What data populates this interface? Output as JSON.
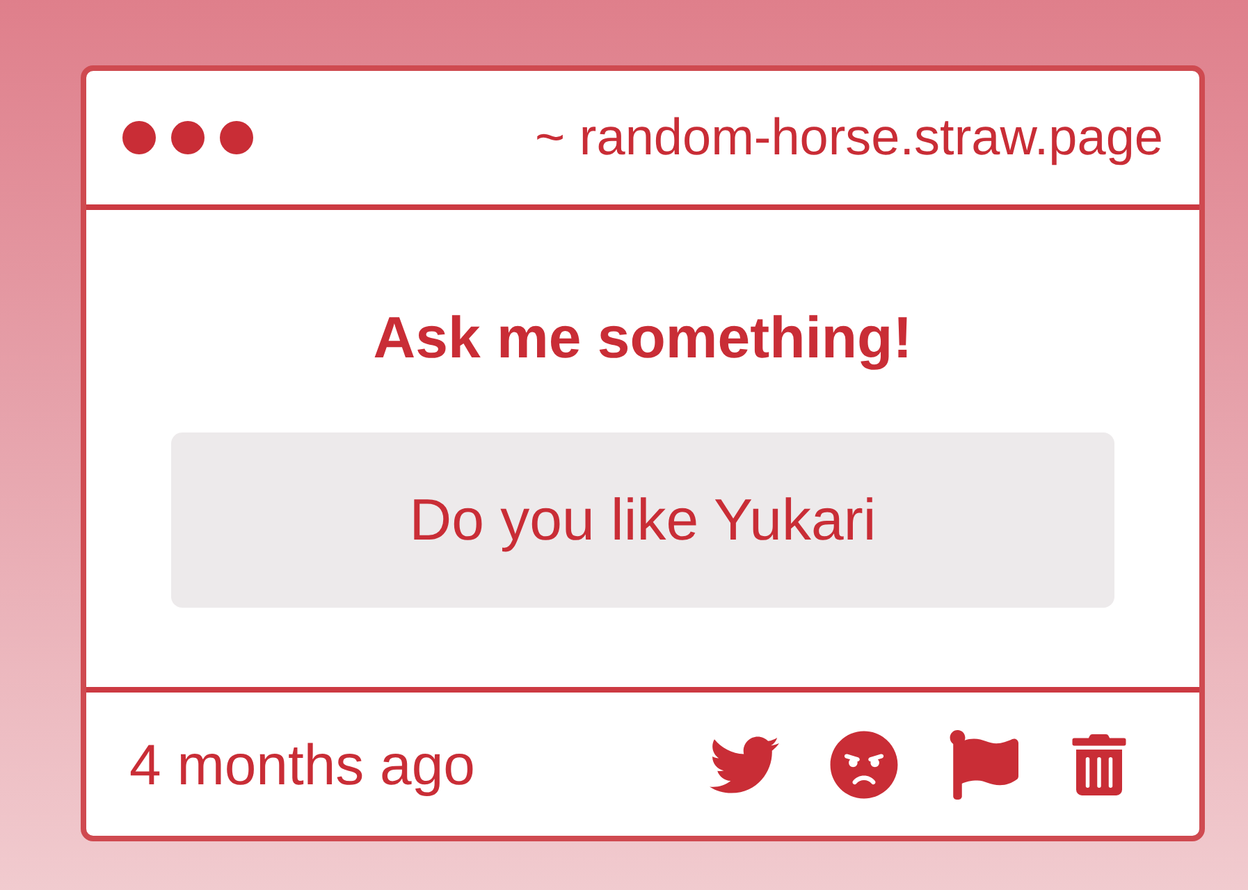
{
  "window": {
    "address": "~ random-horse.straw.page"
  },
  "prompt": {
    "title": "Ask me something!",
    "question": "Do you like Yukari"
  },
  "footer": {
    "time": "4 months ago"
  }
}
